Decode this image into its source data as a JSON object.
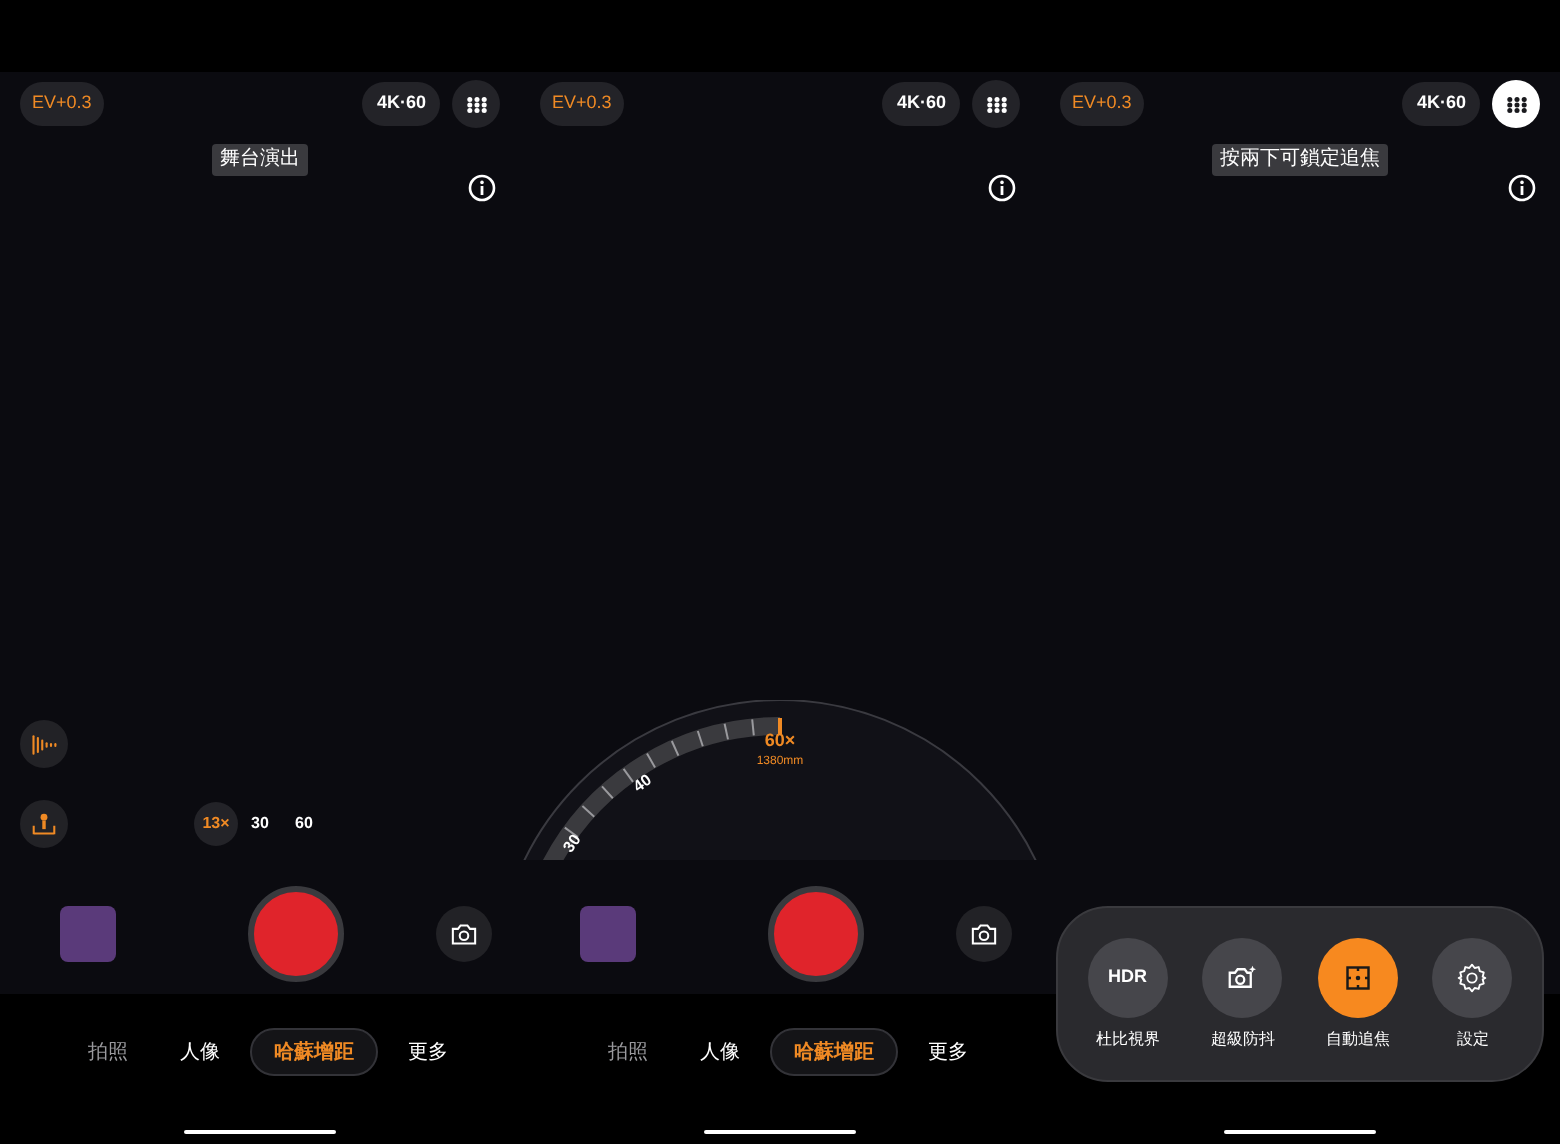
{
  "panels": [
    {
      "kind": "zoom_chips",
      "ev": "EV+0.3",
      "format": "4K·60",
      "grid_open": false,
      "tooltip": "舞台演出",
      "zoom_chips": [
        {
          "label": "13×",
          "selected": true
        },
        {
          "label": "30",
          "selected": false
        },
        {
          "label": "60",
          "selected": false
        }
      ],
      "modes": [
        {
          "label": "拍照",
          "selected": false
        },
        {
          "label": "人像",
          "selected": false
        },
        {
          "label": "哈蘇增距",
          "selected": true
        },
        {
          "label": "更多",
          "selected": false
        }
      ]
    },
    {
      "kind": "zoom_dial",
      "ev": "EV+0.3",
      "format": "4K·60",
      "grid_open": false,
      "zoom_dial": {
        "readout": "60×",
        "focal": "1380mm",
        "labels": [
          "40",
          "30"
        ]
      },
      "modes": [
        {
          "label": "拍照",
          "selected": false
        },
        {
          "label": "人像",
          "selected": false
        },
        {
          "label": "哈蘇增距",
          "selected": true
        },
        {
          "label": "更多",
          "selected": false
        }
      ]
    },
    {
      "kind": "quick_settings",
      "ev": "EV+0.3",
      "format": "4K·60",
      "grid_open": true,
      "tooltip": "按兩下可鎖定追焦",
      "quick_settings": [
        {
          "kind": "text",
          "icon_text": "HDR",
          "label": "杜比視界",
          "on": false
        },
        {
          "kind": "stabilize",
          "label": "超級防抖",
          "on": false
        },
        {
          "kind": "tracking",
          "label": "自動追焦",
          "on": true
        },
        {
          "kind": "settings",
          "label": "設定",
          "on": false
        }
      ]
    }
  ]
}
